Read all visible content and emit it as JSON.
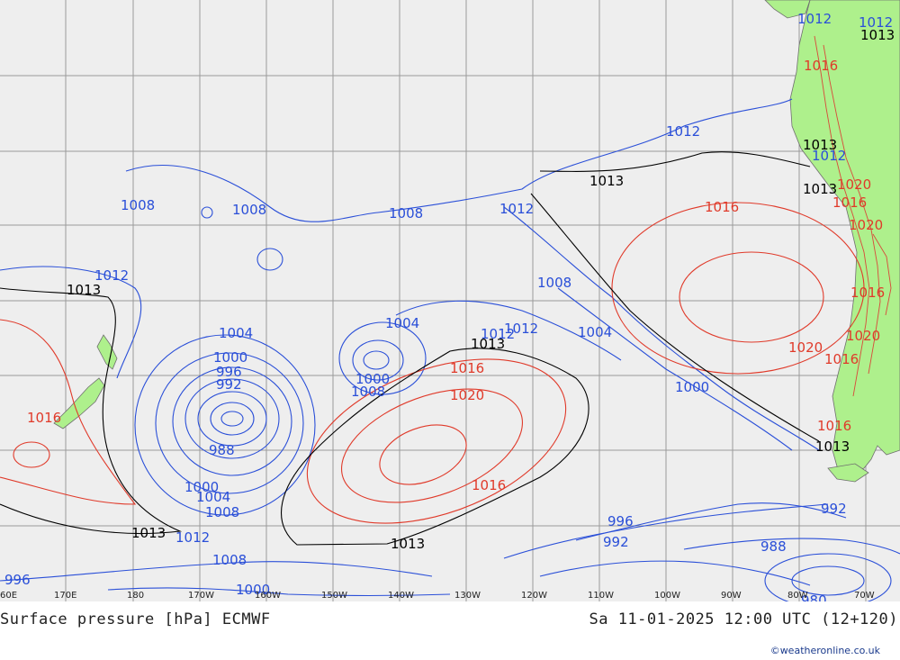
{
  "title": "Surface pressure [hPa] ECMWF",
  "valid_time": "Sa 11-01-2025 12:00 UTC (12+120)",
  "credit": "©weatheronline.co.uk",
  "colors": {
    "ocean": "#eeeeee",
    "land": "#aef08c",
    "grid": "#9a9a9a",
    "low_isobar": "#2a4fd8",
    "high_isobar": "#e03a2a",
    "mean_isobar": "#000000",
    "coast": "#6f6f6f",
    "relief": "#d84a3a"
  },
  "longitude_labels": [
    "60E",
    "170E",
    "180",
    "170W",
    "160W",
    "150W",
    "140W",
    "130W",
    "120W",
    "110W",
    "100W",
    "90W",
    "80W",
    "70W"
  ],
  "isobar_labels": {
    "blue": [
      "1008",
      "1008",
      "1008",
      "1012",
      "1012",
      "1012",
      "1012",
      "1004",
      "1000",
      "996",
      "992",
      "988",
      "1000",
      "1004",
      "1008",
      "1012",
      "1004",
      "1000",
      "1008",
      "1008",
      "1004",
      "1012",
      "1000",
      "996",
      "992",
      "988",
      "992",
      "980",
      "996",
      "1008",
      "1000",
      "1012",
      "1012",
      "1012"
    ],
    "red": [
      "1016",
      "1016",
      "1020",
      "1016",
      "1016",
      "1020",
      "1020",
      "1016",
      "1016",
      "1016",
      "1016",
      "1020",
      "1016",
      "1020"
    ],
    "black": [
      "1013",
      "1013",
      "1013",
      "1013",
      "1013",
      "1013",
      "1013",
      "1013"
    ]
  }
}
